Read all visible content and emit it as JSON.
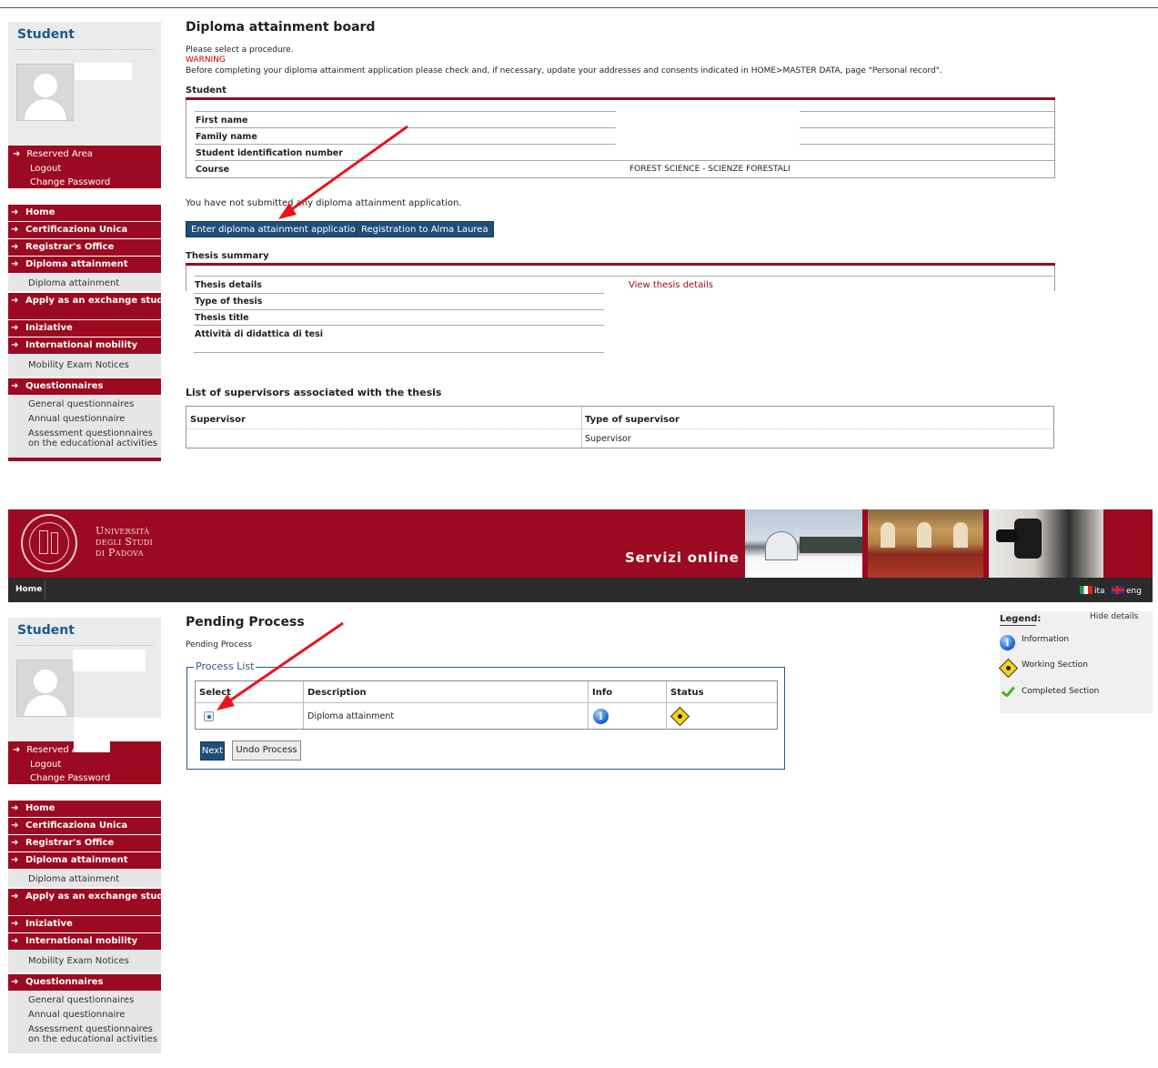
{
  "top": {
    "sidebar": {
      "student_title": "Student",
      "reserved": [
        "Reserved Area",
        "Logout",
        "Change Password"
      ],
      "menu": [
        {
          "label": "Home"
        },
        {
          "label": "Certificaziona Unica"
        },
        {
          "label": "Registrar's Office"
        },
        {
          "label": "Diploma attainment"
        },
        {
          "sub": "Diploma attainment"
        },
        {
          "label": "Apply as an exchange student"
        },
        {
          "label": "Iniziative"
        },
        {
          "label": "International mobility"
        },
        {
          "sub": "Mobility Exam Notices"
        },
        {
          "label": "Questionnaires"
        }
      ],
      "questionnaires_sub": [
        "General questionnaires",
        "Annual questionnaire",
        "Assessment questionnaires on the educational activities"
      ]
    },
    "main": {
      "title": "Diploma attainment board",
      "select_text": "Please select a procedure.",
      "warning_label": "WARNING",
      "warning_text": "Before completing your diploma attainment application please check and, if necessary, update your addresses and consents indicated in HOME>MASTER DATA, page \"Personal record\".",
      "student_section": "Student",
      "student_rows": [
        {
          "label": "First name",
          "value": ""
        },
        {
          "label": "Family name",
          "value": ""
        },
        {
          "label": "Student identification number",
          "value": ""
        },
        {
          "label": "Course",
          "value": "FOREST SCIENCE - SCIENZE FORESTALI"
        }
      ],
      "not_submitted": "You have not submitted any diploma attainment application.",
      "btn_enter": "Enter diploma attainment application",
      "btn_alma": "Registration to Alma Laurea",
      "thesis_section": "Thesis summary",
      "thesis_rows": [
        {
          "label": "Thesis details",
          "value": "View thesis details"
        },
        {
          "label": "Type of thesis",
          "value": ""
        },
        {
          "label": "Thesis title",
          "value": ""
        },
        {
          "label": "Attività di didattica di tesi",
          "value": ""
        }
      ],
      "supervisors_title": "List of supervisors associated with the thesis",
      "supervisors_headers": [
        "Supervisor",
        "Type of supervisor"
      ],
      "supervisors_rows": [
        {
          "name": "",
          "type": "Supervisor"
        }
      ]
    }
  },
  "banner": {
    "university_lines": [
      "Università",
      "degli Studi",
      "di Padova"
    ],
    "servizi": "Servizi online",
    "nav_home": "Home",
    "lang_it": "ita",
    "lang_en": "eng"
  },
  "bottom": {
    "sidebar": {
      "student_title": "Student",
      "reserved": [
        "Reserved Area",
        "Logout",
        "Change Password"
      ],
      "menu": [
        {
          "label": "Home"
        },
        {
          "label": "Certificaziona Unica"
        },
        {
          "label": "Registrar's Office"
        },
        {
          "label": "Diploma attainment"
        },
        {
          "sub": "Diploma attainment"
        },
        {
          "label": "Apply as an exchange student"
        },
        {
          "label": "Iniziative"
        },
        {
          "label": "International mobility"
        },
        {
          "sub": "Mobility Exam Notices"
        },
        {
          "label": "Questionnaires"
        }
      ],
      "questionnaires_sub": [
        "General questionnaires",
        "Annual questionnaire",
        "Assessment questionnaires on the educational activities"
      ]
    },
    "main": {
      "title": "Pending Process",
      "breadcrumb": "Pending Process",
      "process_list_legend": "Process List",
      "headers": [
        "Select",
        "Description",
        "Info",
        "Status"
      ],
      "rows": [
        {
          "description": "Diploma attainment",
          "info_icon": "info-icon",
          "status_icon": "working-section-icon",
          "selected": true
        }
      ],
      "btn_next": "Next",
      "btn_undo": "Undo Process"
    },
    "legend": {
      "title": "Legend:",
      "hide": "Hide details",
      "items": [
        {
          "icon": "info-icon",
          "label": "Information"
        },
        {
          "icon": "working-section-icon",
          "label": "Working Section"
        },
        {
          "icon": "completed-section-icon",
          "label": "Completed Section"
        }
      ]
    }
  },
  "colors": {
    "brand_red": "#9b0a20",
    "button_blue": "#1f4e79",
    "arrow_red": "#e8141c"
  }
}
